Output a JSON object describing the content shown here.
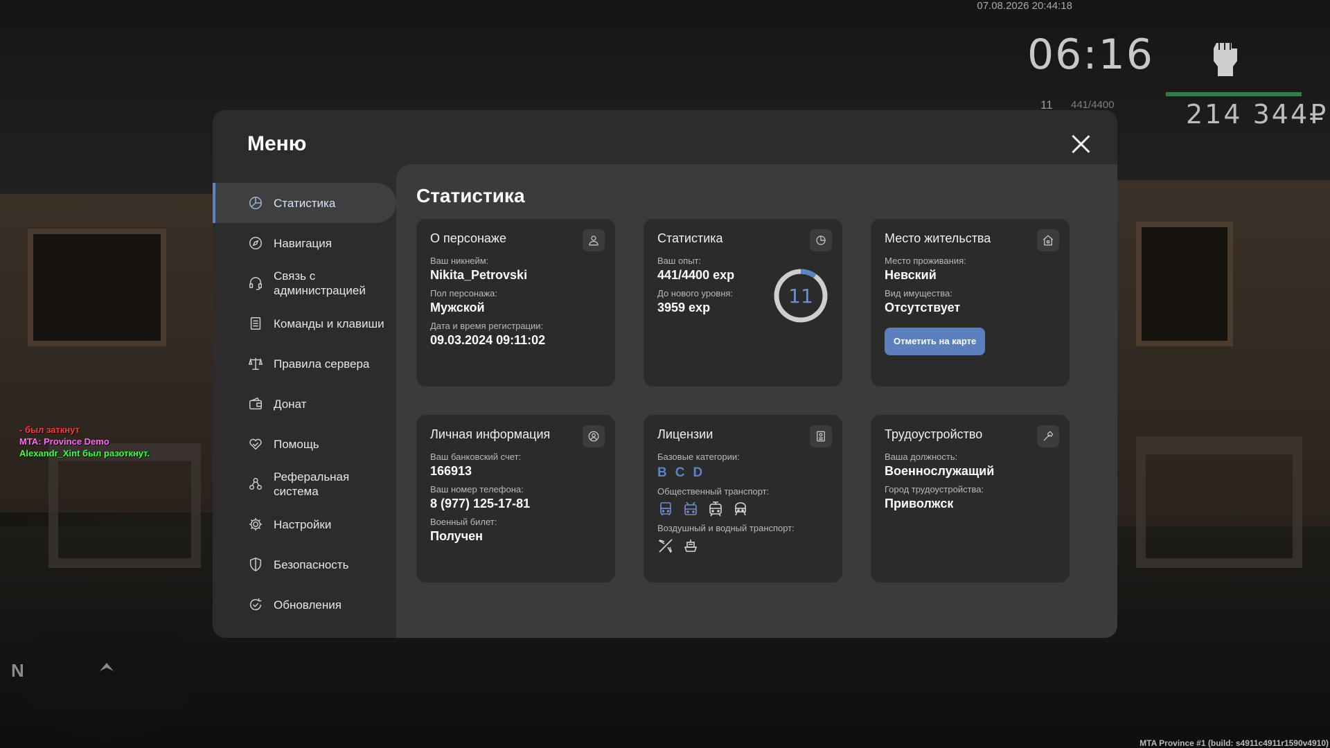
{
  "hud": {
    "datetime": "07.08.2026 20:44:18",
    "clock": "06:16",
    "level": "11",
    "exp": "441/4400",
    "money": "214 344₽"
  },
  "chat": [
    {
      "text": "- был заткнут",
      "color": "#ff3b3b"
    },
    {
      "text": "MTA: Province Demo",
      "color": "#ff6bf0"
    },
    {
      "text": "Alexandr_Xint был разоткнут.",
      "color": "#40ff40"
    }
  ],
  "compass": {
    "north": "N"
  },
  "build_info": "MTA Province #1 (build: s4911c4911r1590v4910)",
  "menu": {
    "title": "Меню",
    "sidebar": [
      {
        "label": "Статистика",
        "icon": "pie-chart-icon",
        "active": true
      },
      {
        "label": "Навигация",
        "icon": "compass-icon"
      },
      {
        "label": "Связь с администрацией",
        "icon": "headset-icon"
      },
      {
        "label": "Команды и клавиши",
        "icon": "document-list-icon"
      },
      {
        "label": "Правила сервера",
        "icon": "scales-icon"
      },
      {
        "label": "Донат",
        "icon": "wallet-icon"
      },
      {
        "label": "Помощь",
        "icon": "heart-hand-icon"
      },
      {
        "label": "Реферальная система",
        "icon": "referral-users-icon"
      },
      {
        "label": "Настройки",
        "icon": "gear-icon"
      },
      {
        "label": "Безопасность",
        "icon": "shield-icon"
      },
      {
        "label": "Обновления",
        "icon": "refresh-check-icon"
      }
    ]
  },
  "content": {
    "title": "Статистика",
    "character": {
      "title": "О персонаже",
      "nick_label": "Ваш никнейм:",
      "nick": "Nikita_Petrovski",
      "gender_label": "Пол персонажа:",
      "gender": "Мужской",
      "reg_label": "Дата и время регистрации:",
      "reg": "09.03.2024 09:11:02"
    },
    "stats": {
      "title": "Статистика",
      "exp_label": "Ваш опыт:",
      "exp": "441/4400 exp",
      "next_label": "До нового уровня:",
      "next": "3959 exp",
      "level": "11",
      "progress_fraction": 0.1,
      "accent": "#5d83c3"
    },
    "residence": {
      "title": "Место жительства",
      "place_label": "Место проживания:",
      "place": "Невский",
      "property_label": "Вид имущества:",
      "property": "Отсутствует",
      "map_button": "Отметить на карте"
    },
    "personal": {
      "title": "Личная информация",
      "bank_label": "Ваш банковский счет:",
      "bank": "166913",
      "phone_label": "Ваш номер телефона:",
      "phone": "8 (977) 125-17-81",
      "military_label": "Военный билет:",
      "military": "Получен"
    },
    "licenses": {
      "title": "Лицензии",
      "base_label": "Базовые категории:",
      "base": [
        "B",
        "C",
        "D"
      ],
      "public_label": "Общественный транспорт:",
      "public": [
        {
          "icon": "bus-icon",
          "active": true
        },
        {
          "icon": "trolleybus-icon",
          "active": true
        },
        {
          "icon": "tram-icon",
          "active": false
        },
        {
          "icon": "train-icon",
          "active": false
        }
      ],
      "air_label": "Воздушный и водный транспорт:",
      "air": [
        {
          "icon": "plane-icon",
          "active": false
        },
        {
          "icon": "ship-icon",
          "active": false
        }
      ]
    },
    "employment": {
      "title": "Трудоустройство",
      "position_label": "Ваша должность:",
      "position": "Военнослужащий",
      "city_label": "Город трудоустройства:",
      "city": "Приволжск"
    }
  }
}
